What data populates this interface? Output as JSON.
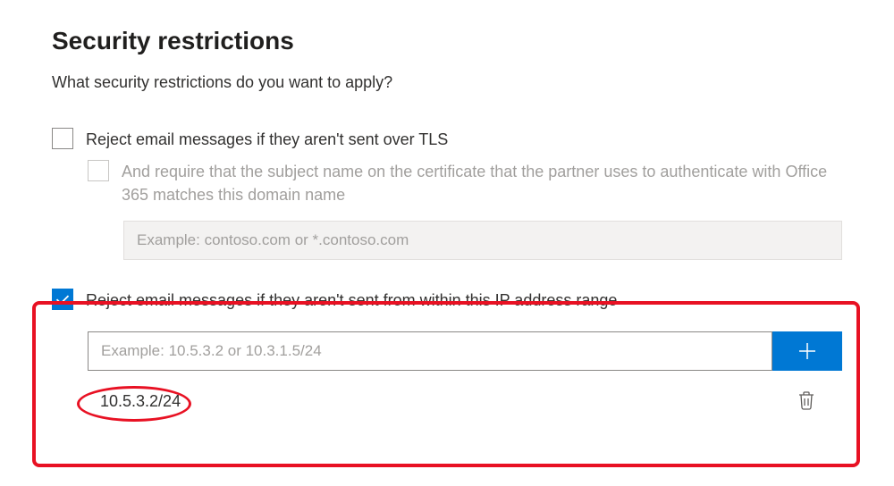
{
  "heading": "Security restrictions",
  "subtitle": "What security restrictions do you want to apply?",
  "tls": {
    "checked": false,
    "label": "Reject email messages if they aren't sent over TLS",
    "sub": {
      "checked": false,
      "disabled": true,
      "label": "And require that the subject name on the certificate that the partner uses to authenticate with Office 365 matches this domain name",
      "placeholder": "Example: contoso.com or *.contoso.com",
      "value": ""
    }
  },
  "ip": {
    "checked": true,
    "label": "Reject email messages if they aren't sent from within this IP address range",
    "placeholder": "Example: 10.5.3.2 or 10.3.1.5/24",
    "value": "",
    "entries": [
      "10.5.3.2/24"
    ]
  }
}
